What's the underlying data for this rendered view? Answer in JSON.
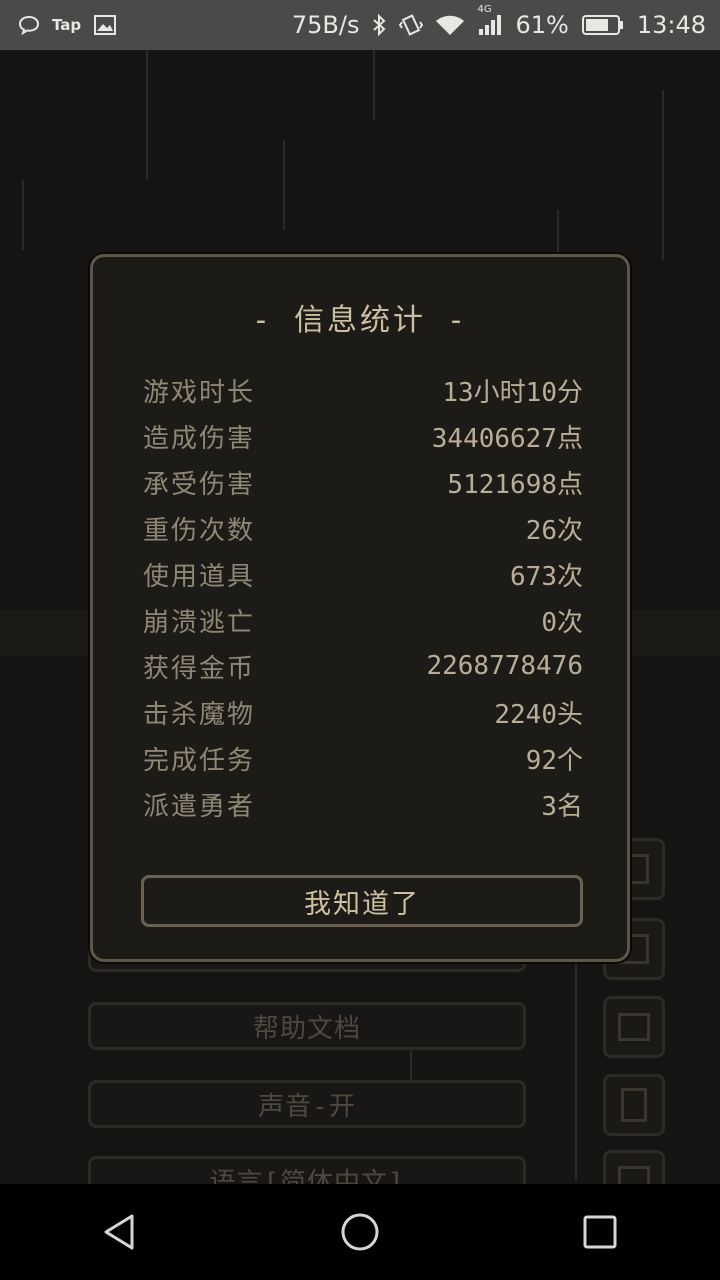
{
  "status_bar": {
    "speed": "75B/s",
    "network": "4G",
    "battery": "61%",
    "time": "13:48",
    "tap_label": "Tap",
    "icons": [
      "chat-icon",
      "tap-icon",
      "image-icon",
      "bluetooth-icon",
      "vibrate-icon",
      "wifi-icon",
      "signal-icon",
      "battery-icon"
    ]
  },
  "background_menu": {
    "items": [
      "帮助文档",
      "声音-开",
      "语言[简体中文]"
    ]
  },
  "dialog": {
    "title": "- 信息统计 -",
    "stats": [
      {
        "label": "游戏时长",
        "value": "13小时10分"
      },
      {
        "label": "造成伤害",
        "value": "34406627点"
      },
      {
        "label": "承受伤害",
        "value": "5121698点"
      },
      {
        "label": "重伤次数",
        "value": "26次"
      },
      {
        "label": "使用道具",
        "value": "673次"
      },
      {
        "label": "崩溃逃亡",
        "value": "0次"
      },
      {
        "label": "获得金币",
        "value": "2268778476"
      },
      {
        "label": "击杀魔物",
        "value": "2240头"
      },
      {
        "label": "完成任务",
        "value": "92个"
      },
      {
        "label": "派遣勇者",
        "value": "3名"
      }
    ],
    "confirm_label": "我知道了"
  },
  "colors": {
    "panel_bg": "#1d1b17",
    "panel_border": "#5e5649",
    "text": "#b9ad96"
  }
}
